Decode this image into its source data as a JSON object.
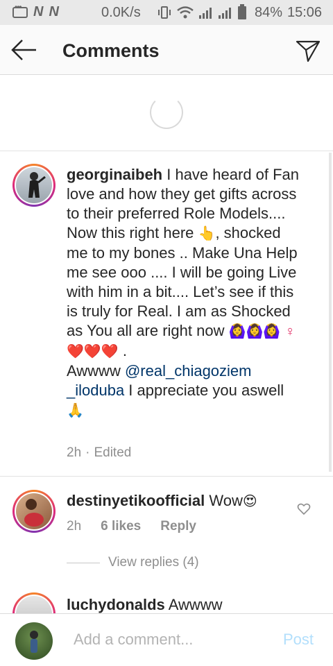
{
  "status_bar": {
    "network_speed": "0.0K/s",
    "battery_percent": "84%",
    "time": "15:06",
    "n_label": "N"
  },
  "header": {
    "title": "Comments",
    "back_icon": "arrow-left-icon",
    "send_icon": "paper-plane-icon"
  },
  "comments": [
    {
      "username": "georginaibeh",
      "body_part1": " I have heard of Fan love and how they get gifts across to their preferred Role Models.... Now this right here ",
      "body_part2": ", shocked me to my bones .. Make Una Help me see ooo .... I will be going Live with him in a bit.... Let’s see if this is truly for Real. I am as Shocked as You all are right now ",
      "body_part3": " .",
      "body_part4": "Awwww ",
      "mention": "@real_chiagoziem _iloduba",
      "body_part5": " I appreciate you aswell ",
      "time": "2h",
      "edited": "Edited",
      "emoji_point": "👆",
      "emoji_row": "🙆‍♀️🙆‍♀️🙆‍♀️",
      "emoji_hearts": "♀❤️❤️❤️",
      "emoji_pray": "🙏"
    },
    {
      "username": "destinyetikoofficial",
      "body": " Wow",
      "emoji": "😍",
      "time": "2h",
      "likes": "6 likes",
      "reply": "Reply"
    },
    {
      "username": "luchydonalds",
      "body": " Awwww"
    }
  ],
  "view_replies": "View replies (4)",
  "composer": {
    "placeholder": "Add a comment...",
    "post_label": "Post"
  },
  "colors": {
    "link": "#003569",
    "post_disabled": "#b2dffc",
    "muted": "#8e8e8e"
  }
}
